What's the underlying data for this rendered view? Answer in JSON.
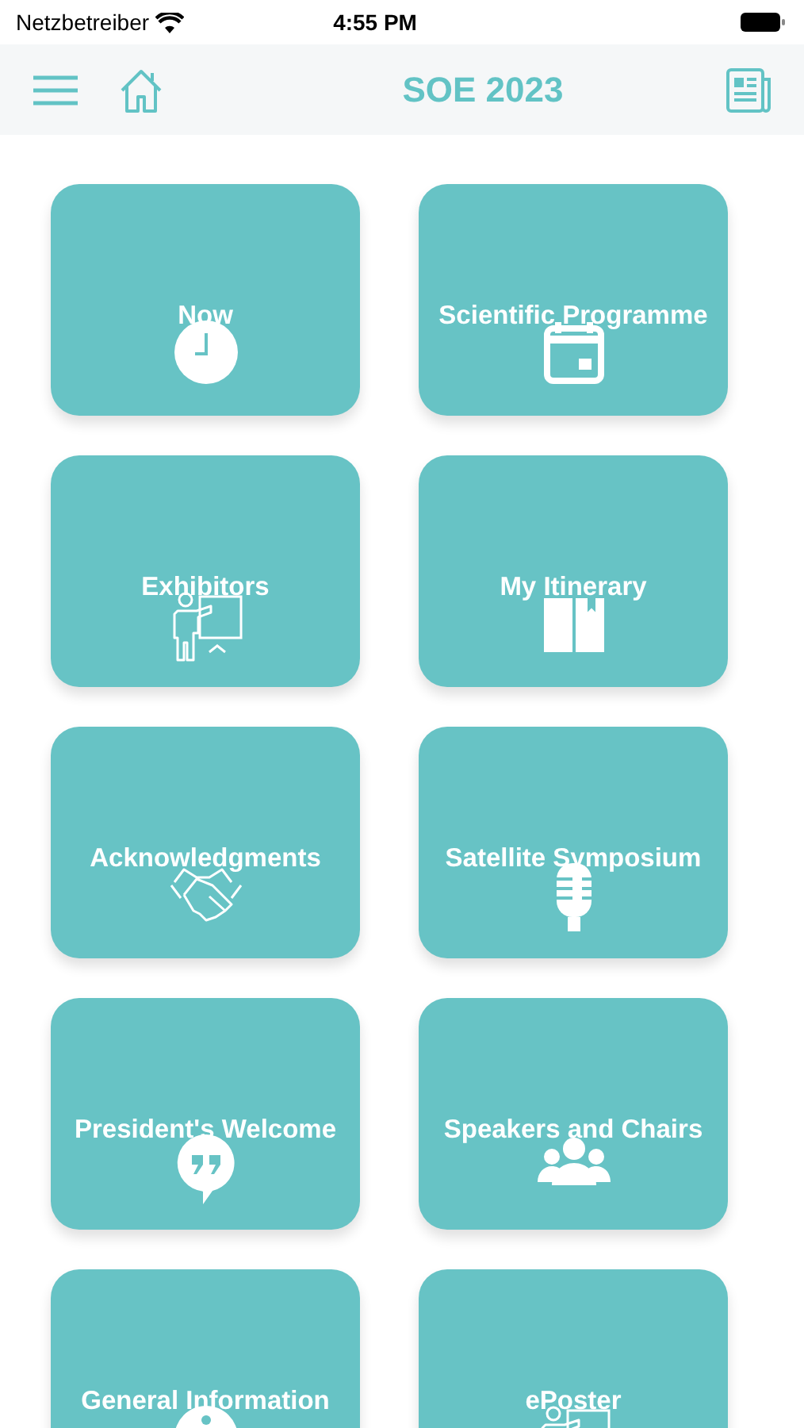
{
  "status_bar": {
    "carrier": "Netzbetreiber",
    "time": "4:55 PM"
  },
  "header": {
    "title": "SOE 2023"
  },
  "tiles": [
    {
      "label": "Now",
      "kind": "clock"
    },
    {
      "label": "Scientific Programme",
      "kind": "calendar"
    },
    {
      "label": "Exhibitors",
      "kind": "presenter"
    },
    {
      "label": "My Itinerary",
      "kind": "book"
    },
    {
      "label": "Acknowledgments",
      "kind": "handshake"
    },
    {
      "label": "Satellite Symposium",
      "kind": "microphone"
    },
    {
      "label": "President's Welcome",
      "kind": "quote"
    },
    {
      "label": "Speakers and Chairs",
      "kind": "people"
    },
    {
      "label": "General Information",
      "kind": "info"
    },
    {
      "label": "ePoster",
      "kind": "presenter"
    }
  ]
}
